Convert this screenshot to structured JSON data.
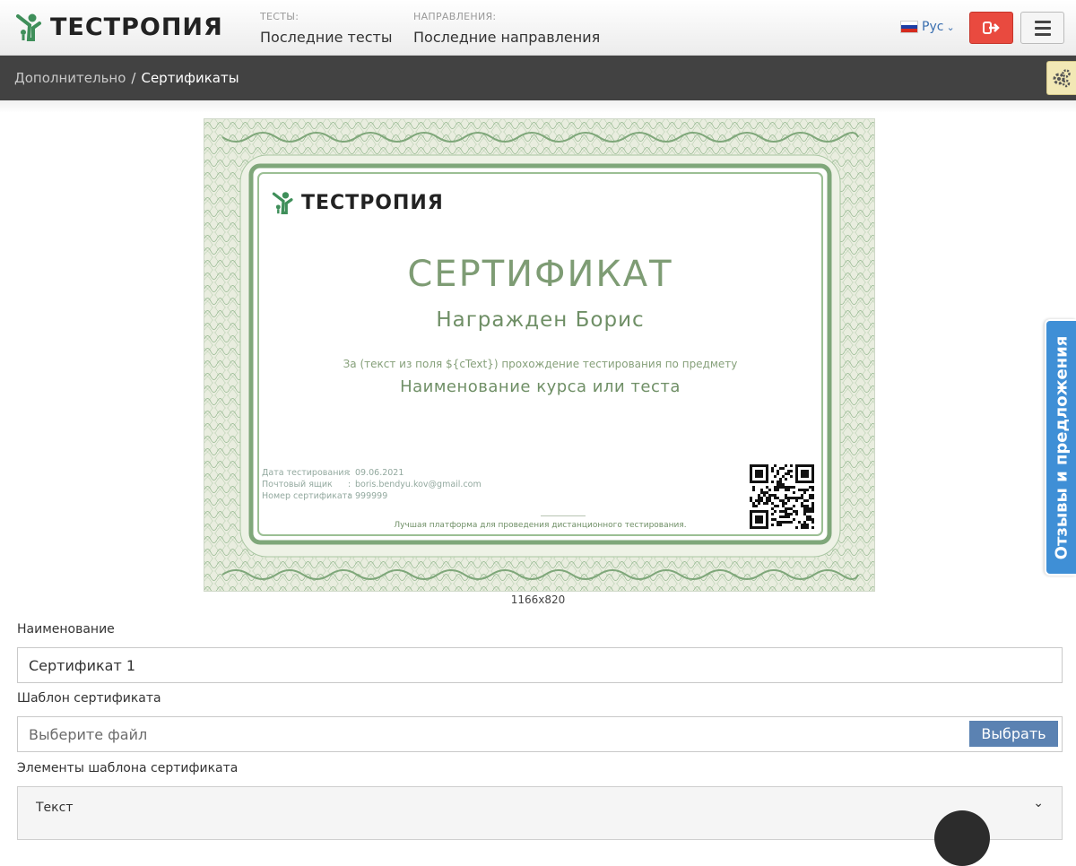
{
  "header": {
    "logo_text": "ТЕСТРОПИЯ",
    "nav": [
      {
        "caption": "ТЕСТЫ:",
        "link": "Последние тесты"
      },
      {
        "caption": "НАПРАВЛЕНИЯ:",
        "link": "Последние направления"
      }
    ],
    "language": "Рус",
    "colors": {
      "logout": "#e94a3f",
      "accent": "#3a6fb0"
    }
  },
  "breadcrumb": {
    "parent": "Дополнительно",
    "separator": "/",
    "current": "Сертификаты"
  },
  "certificate": {
    "logo_text": "ТЕСТРОПИЯ",
    "title": "СЕРТИФИКАТ",
    "awarded": "Награжден Борис",
    "for_text": "За (текст из поля ${cText}) прохождение тестирования по предмету",
    "course": "Наименование курса или теста",
    "details": [
      {
        "label": "Дата тестирования",
        "value": "09.06.2021"
      },
      {
        "label": "Почтовый ящик",
        "value": "boris.bendyu.kov@gmail.com"
      },
      {
        "label": "Номер сертификата",
        "value": "999999"
      }
    ],
    "slogan": "Лучшая платформа для проведения дистанционного тестирования.",
    "dimensions": "1166x820"
  },
  "feedback_tab": "Отзывы и предложения",
  "form": {
    "name_label": "Наименование",
    "name_value": "Сертификат 1",
    "template_label": "Шаблон сертификата",
    "template_placeholder": "Выберите файл",
    "pick_button": "Выбрать",
    "elements_label": "Элементы шаблона сертификата",
    "accordion_item": "Текст"
  }
}
